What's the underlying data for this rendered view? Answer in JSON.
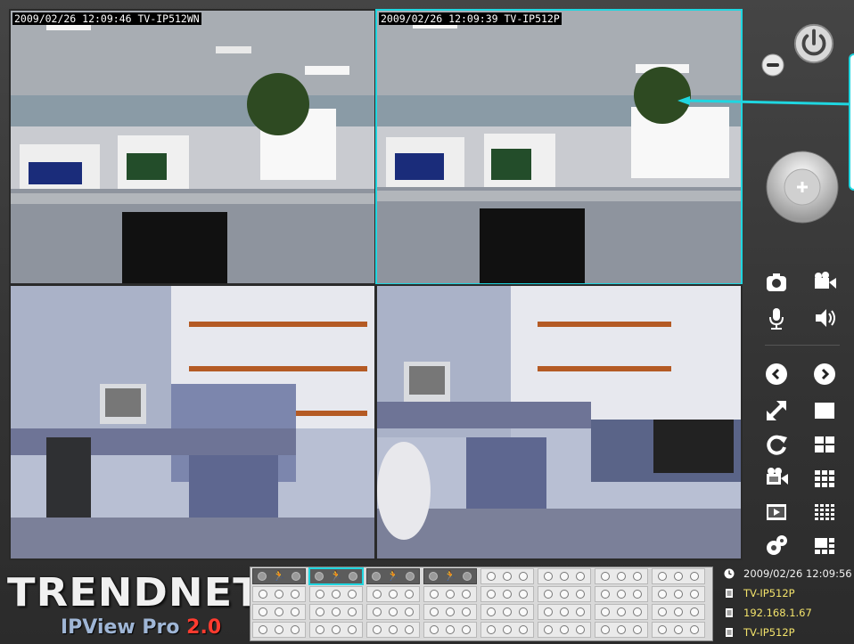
{
  "app": {
    "brand": "TRENDnet",
    "product": "IPView Pro ",
    "version": "2.0"
  },
  "cameras": [
    {
      "timestamp": "2009/02/26 12:09:46 TV-IP512WN",
      "selected": false
    },
    {
      "timestamp": "2009/02/26 12:09:39 TV-IP512P",
      "selected": true
    },
    {
      "timestamp": "",
      "selected": false
    },
    {
      "timestamp": "",
      "selected": false
    }
  ],
  "controls": {
    "minimize": "minimize-icon",
    "power": "power-icon",
    "ptz": "ptz-dial-icon",
    "snapshot": "camera-icon",
    "record": "video-camera-icon",
    "microphone": "microphone-icon",
    "speaker": "speaker-icon",
    "prev": "chevron-left-icon",
    "next": "chevron-right-icon",
    "fullscreen": "expand-icon",
    "layout_1": "single-view-icon",
    "refresh": "refresh-icon",
    "layout_4": "quad-view-icon",
    "playback": "film-reel-icon",
    "layout_9": "nine-view-icon",
    "player": "media-player-icon",
    "layout_16": "sixteen-view-icon",
    "settings": "gears-icon",
    "layout_custom": "custom-layout-icon"
  },
  "channels": {
    "rows": 4,
    "cols": 8,
    "active": [
      0,
      1,
      2,
      3
    ],
    "selected": 1
  },
  "status": {
    "datetime": "2009/02/26 12:09:56",
    "camera_name": "TV-IP512P",
    "ip": "192.168.1.67",
    "camera_model": "TV-IP512P"
  },
  "colors": {
    "accent": "#1fd6e0",
    "status_yellow": "#f3e36b",
    "version_red": "#ff3b2f"
  }
}
